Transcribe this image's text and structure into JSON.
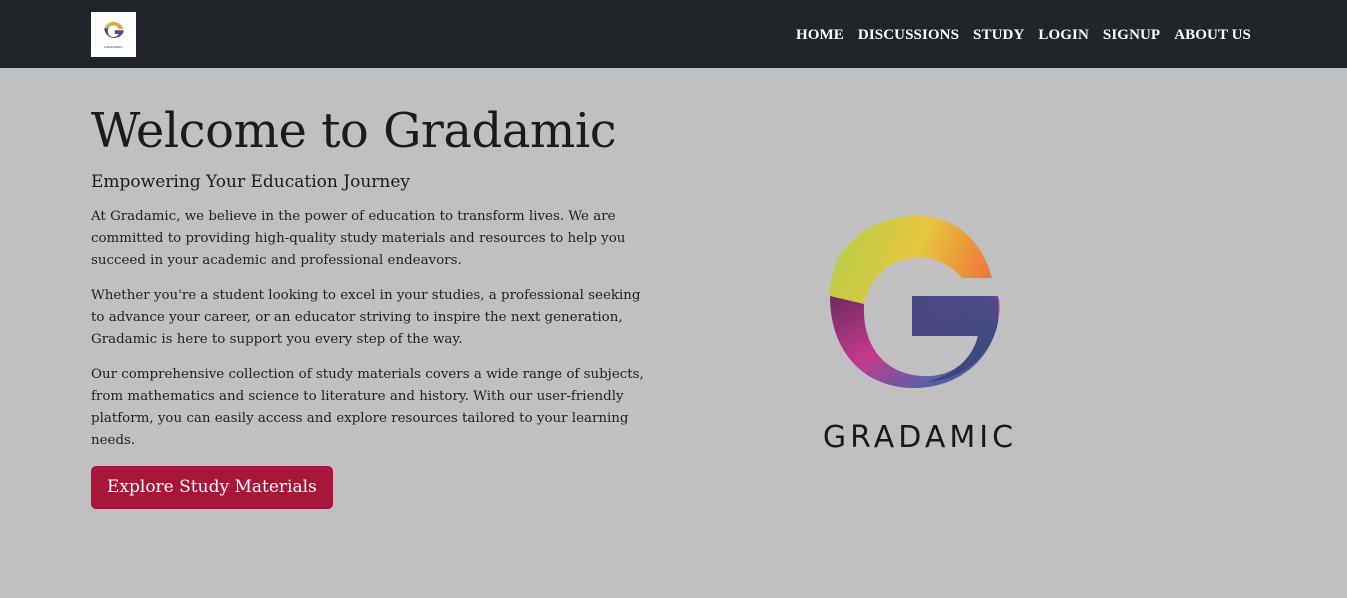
{
  "nav": {
    "brand_text": "GRADAMIC",
    "links": [
      "HOME",
      "DISCUSSIONS",
      "STUDY",
      "LOGIN",
      "SIGNUP",
      "ABOUT US"
    ]
  },
  "hero": {
    "title": "Welcome to Gradamic",
    "subtitle": "Empowering Your Education Journey",
    "paragraphs": [
      "At Gradamic, we believe in the power of education to transform lives. We are committed to providing high-quality study materials and resources to help you succeed in your academic and professional endeavors.",
      "Whether you're a student looking to excel in your studies, a professional seeking to advance your career, or an educator striving to inspire the next generation, Gradamic is here to support you every step of the way.",
      "Our comprehensive collection of study materials covers a wide range of subjects, from mathematics and science to literature and history. With our user-friendly platform, you can easily access and explore resources tailored to your learning needs."
    ],
    "cta_label": "Explore Study Materials",
    "logo_text": "GRADAMIC"
  },
  "colors": {
    "navbar": "#212529",
    "background": "#c0c0c0",
    "cta": "#a8163a"
  }
}
